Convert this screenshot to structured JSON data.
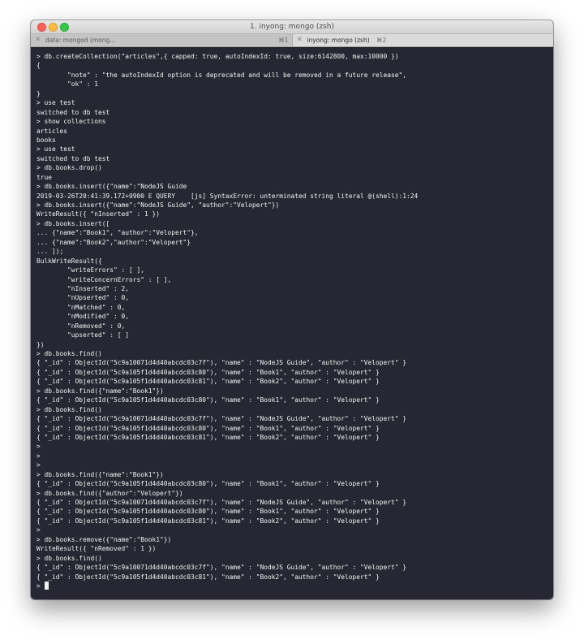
{
  "window": {
    "title": "1. inyong: mongo (zsh)"
  },
  "tabs": [
    {
      "label": "data: mongod (mong...",
      "shortcut": "⌘1",
      "active": false
    },
    {
      "label": "inyong: mongo (zsh)",
      "shortcut": "⌘2",
      "active": true
    }
  ],
  "terminal": {
    "lines": [
      "> db.createCollection(\"articles\",{ capped: true, autoIndexId: true, size:6142800, max:10000 })",
      "{",
      "        \"note\" : \"the autoIndexId option is deprecated and will be removed in a future release\",",
      "        \"ok\" : 1",
      "}",
      "> use test",
      "switched to db test",
      "> show collections",
      "articles",
      "books",
      "> use test",
      "switched to db test",
      "> db.books.drop()",
      "true",
      "> db.books.insert({\"name\":\"NodeJS Guide",
      "2019-03-26T20:41:39.172+0900 E QUERY    [js] SyntaxError: unterminated string literal @(shell):1:24",
      "> db.books.insert({\"name\":\"NodeJS Guide\", \"author\":\"Velopert\"})",
      "WriteResult({ \"nInserted\" : 1 })",
      "> db.books.insert([",
      "... {\"name\":\"Book1\", \"author\":\"Velopert\"},",
      "... {\"name\":\"Book2\",\"author\":\"Velopert\"}",
      "... ]);",
      "BulkWriteResult({",
      "        \"writeErrors\" : [ ],",
      "        \"writeConcernErrors\" : [ ],",
      "        \"nInserted\" : 2,",
      "        \"nUpserted\" : 0,",
      "        \"nMatched\" : 0,",
      "        \"nModified\" : 0,",
      "        \"nRemoved\" : 0,",
      "        \"upserted\" : [ ]",
      "})",
      "> db.books.find()",
      "{ \"_id\" : ObjectId(\"5c9a10071d4d40abcdc03c7f\"), \"name\" : \"NodeJS Guide\", \"author\" : \"Velopert\" }",
      "{ \"_id\" : ObjectId(\"5c9a105f1d4d40abcdc03c80\"), \"name\" : \"Book1\", \"author\" : \"Velopert\" }",
      "{ \"_id\" : ObjectId(\"5c9a105f1d4d40abcdc03c81\"), \"name\" : \"Book2\", \"author\" : \"Velopert\" }",
      "> db.books.find({\"name\":\"Book1\"})",
      "{ \"_id\" : ObjectId(\"5c9a105f1d4d40abcdc03c80\"), \"name\" : \"Book1\", \"author\" : \"Velopert\" }",
      "> db.books.find()",
      "{ \"_id\" : ObjectId(\"5c9a10071d4d40abcdc03c7f\"), \"name\" : \"NodeJS Guide\", \"author\" : \"Velopert\" }",
      "{ \"_id\" : ObjectId(\"5c9a105f1d4d40abcdc03c80\"), \"name\" : \"Book1\", \"author\" : \"Velopert\" }",
      "{ \"_id\" : ObjectId(\"5c9a105f1d4d40abcdc03c81\"), \"name\" : \"Book2\", \"author\" : \"Velopert\" }",
      ">",
      ">",
      ">",
      "> db.books.find({\"name\":\"Book1\"})",
      "{ \"_id\" : ObjectId(\"5c9a105f1d4d40abcdc03c80\"), \"name\" : \"Book1\", \"author\" : \"Velopert\" }",
      "> db.books.find({\"author\":\"Velopert\"})",
      "{ \"_id\" : ObjectId(\"5c9a10071d4d40abcdc03c7f\"), \"name\" : \"NodeJS Guide\", \"author\" : \"Velopert\" }",
      "{ \"_id\" : ObjectId(\"5c9a105f1d4d40abcdc03c80\"), \"name\" : \"Book1\", \"author\" : \"Velopert\" }",
      "{ \"_id\" : ObjectId(\"5c9a105f1d4d40abcdc03c81\"), \"name\" : \"Book2\", \"author\" : \"Velopert\" }",
      ">",
      "> db.books.remove({\"name\":\"Book1\"})",
      "WriteResult({ \"nRemoved\" : 1 })",
      "> db.books.find()",
      "{ \"_id\" : ObjectId(\"5c9a10071d4d40abcdc03c7f\"), \"name\" : \"NodeJS Guide\", \"author\" : \"Velopert\" }",
      "{ \"_id\" : ObjectId(\"5c9a105f1d4d40abcdc03c81\"), \"name\" : \"Book2\", \"author\" : \"Velopert\" }"
    ],
    "prompt": "> "
  },
  "colors": {
    "terminal_background": "#262732",
    "terminal_text": "#f2f2f2",
    "close_button": "#fc605c",
    "minimize_button": "#fdbc40",
    "maximize_button": "#34c84a"
  }
}
